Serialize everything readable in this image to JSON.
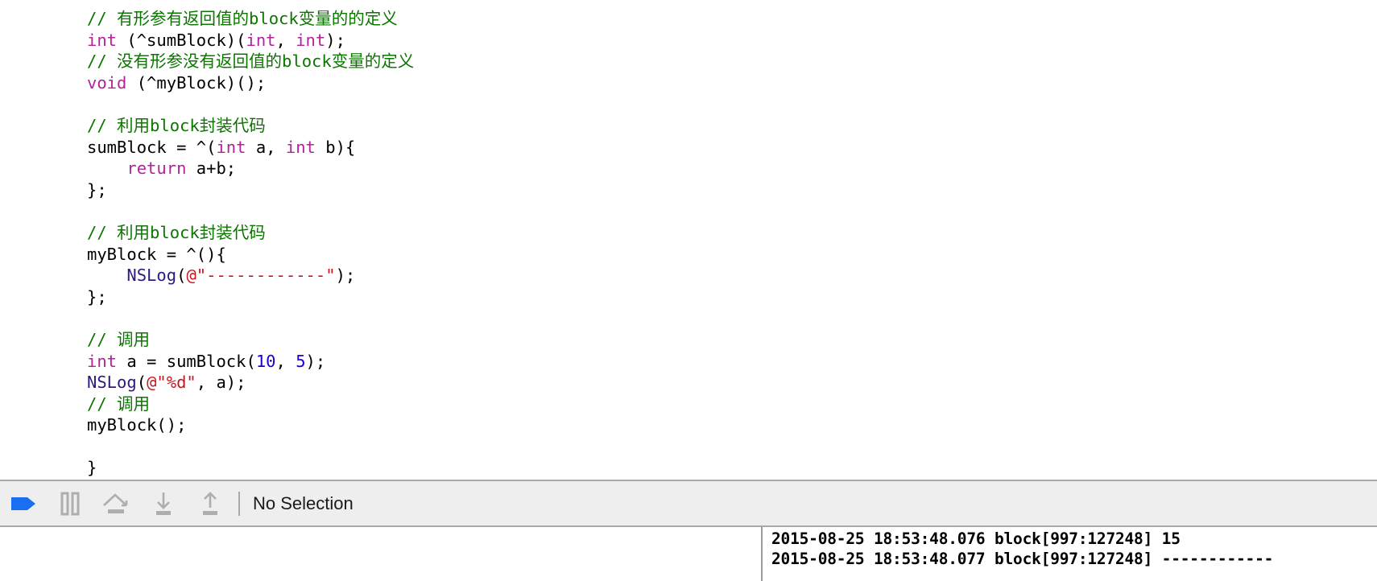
{
  "editor": {
    "language": "objective-c",
    "colors": {
      "comment": "#0B7500",
      "keyword": "#B4229A",
      "string": "#C8161D",
      "number": "#1C00CF",
      "function": "#2F1A80",
      "plain": "#000000",
      "background": "#ffffff"
    },
    "lines": [
      [
        {
          "t": "// 有形参有返回值的block变量的的定义",
          "c": "cmt"
        }
      ],
      [
        {
          "t": "int",
          "c": "kw"
        },
        {
          "t": " (^sumBlock)(",
          "c": "plain"
        },
        {
          "t": "int",
          "c": "kw"
        },
        {
          "t": ", ",
          "c": "plain"
        },
        {
          "t": "int",
          "c": "kw"
        },
        {
          "t": ");",
          "c": "plain"
        }
      ],
      [
        {
          "t": "// 没有形参没有返回值的block变量的定义",
          "c": "cmt"
        }
      ],
      [
        {
          "t": "void",
          "c": "kw"
        },
        {
          "t": " (^myBlock)();",
          "c": "plain"
        }
      ],
      [
        {
          "t": "",
          "c": "plain"
        }
      ],
      [
        {
          "t": "// 利用block封装代码",
          "c": "cmt"
        }
      ],
      [
        {
          "t": "sumBlock = ^(",
          "c": "plain"
        },
        {
          "t": "int",
          "c": "kw"
        },
        {
          "t": " a, ",
          "c": "plain"
        },
        {
          "t": "int",
          "c": "kw"
        },
        {
          "t": " b){",
          "c": "plain"
        }
      ],
      [
        {
          "t": "    ",
          "c": "plain"
        },
        {
          "t": "return",
          "c": "kw"
        },
        {
          "t": " a+b;",
          "c": "plain"
        }
      ],
      [
        {
          "t": "};",
          "c": "plain"
        }
      ],
      [
        {
          "t": "",
          "c": "plain"
        }
      ],
      [
        {
          "t": "// 利用block封装代码",
          "c": "cmt"
        }
      ],
      [
        {
          "t": "myBlock = ^(){",
          "c": "plain"
        }
      ],
      [
        {
          "t": "    ",
          "c": "plain"
        },
        {
          "t": "NSLog",
          "c": "fn"
        },
        {
          "t": "(",
          "c": "plain"
        },
        {
          "t": "@\"------------\"",
          "c": "str"
        },
        {
          "t": ");",
          "c": "plain"
        }
      ],
      [
        {
          "t": "};",
          "c": "plain"
        }
      ],
      [
        {
          "t": "",
          "c": "plain"
        }
      ],
      [
        {
          "t": "// 调用",
          "c": "cmt"
        }
      ],
      [
        {
          "t": "int",
          "c": "kw"
        },
        {
          "t": " a = sumBlock(",
          "c": "plain"
        },
        {
          "t": "10",
          "c": "num"
        },
        {
          "t": ", ",
          "c": "plain"
        },
        {
          "t": "5",
          "c": "num"
        },
        {
          "t": ");",
          "c": "plain"
        }
      ],
      [
        {
          "t": "NSLog",
          "c": "fn"
        },
        {
          "t": "(",
          "c": "plain"
        },
        {
          "t": "@\"%d\"",
          "c": "str"
        },
        {
          "t": ", a);",
          "c": "plain"
        }
      ],
      [
        {
          "t": "// 调用",
          "c": "cmt"
        }
      ],
      [
        {
          "t": "myBlock();",
          "c": "plain"
        }
      ],
      [
        {
          "t": "",
          "c": "plain"
        }
      ],
      [
        {
          "t": "}",
          "c": "plain"
        }
      ]
    ]
  },
  "debug_bar": {
    "buttons": [
      {
        "name": "continue-button",
        "icon": "play-flag-icon",
        "label": "Continue program execution",
        "color": "#1a6ef0"
      },
      {
        "name": "pause-button",
        "icon": "pause-icon",
        "label": "Pause",
        "color": "#aeaeae"
      },
      {
        "name": "step-over-button",
        "icon": "step-over-icon",
        "label": "Step over",
        "color": "#aeaeae"
      },
      {
        "name": "step-into-button",
        "icon": "step-into-icon",
        "label": "Step into",
        "color": "#aeaeae"
      },
      {
        "name": "step-out-button",
        "icon": "step-out-icon",
        "label": "Step out",
        "color": "#aeaeae"
      }
    ],
    "selection_label": "No Selection"
  },
  "console": {
    "lines": [
      "2015-08-25 18:53:48.076 block[997:127248] 15",
      "2015-08-25 18:53:48.077 block[997:127248] ------------"
    ]
  },
  "variables_pane": {
    "content": ""
  }
}
